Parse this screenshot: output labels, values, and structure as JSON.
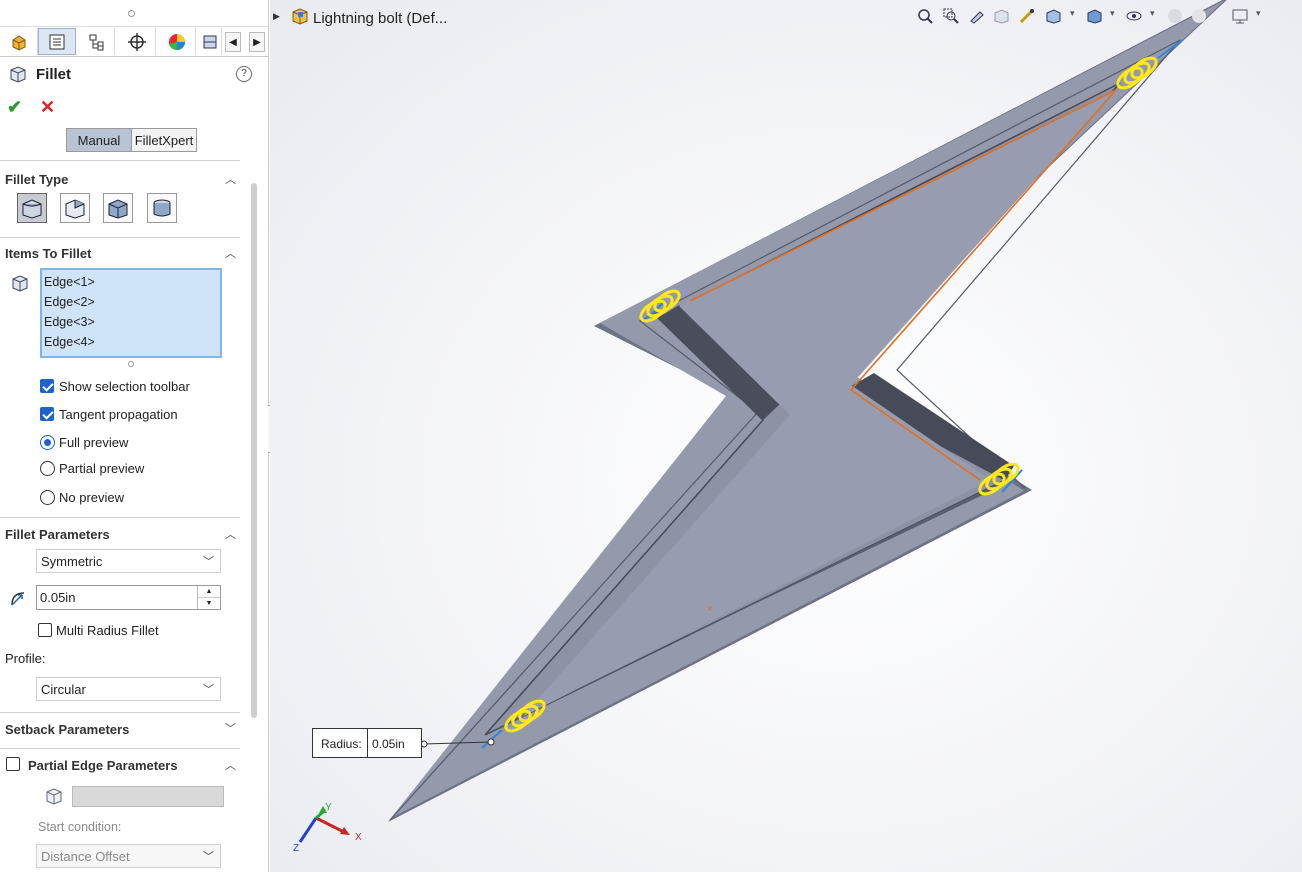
{
  "document": {
    "title": "Lightning bolt  (Def..."
  },
  "property_manager": {
    "title": "Fillet",
    "help_label": "?",
    "ok_icon": "checkmark-icon",
    "cancel_icon": "x-icon",
    "mode_tabs": {
      "manual": "Manual",
      "filletxpert": "FilletXpert",
      "selected": "Manual"
    },
    "fillet_type": {
      "label": "Fillet Type",
      "selected_index": 0
    },
    "items_to_fillet": {
      "label": "Items To Fillet",
      "edges": [
        "Edge<1>",
        "Edge<2>",
        "Edge<3>",
        "Edge<4>"
      ],
      "show_selection_toolbar": {
        "label": "Show selection toolbar",
        "checked": true
      },
      "tangent_propagation": {
        "label": "Tangent propagation",
        "checked": true
      },
      "preview": {
        "full": "Full preview",
        "partial": "Partial preview",
        "none": "No preview",
        "selected": "Full preview"
      }
    },
    "fillet_parameters": {
      "label": "Fillet Parameters",
      "method": "Symmetric",
      "radius": "0.05in",
      "multi_radius": {
        "label": "Multi Radius Fillet",
        "checked": false
      },
      "profile_label": "Profile:",
      "profile": "Circular"
    },
    "setback_parameters": {
      "label": "Setback Parameters"
    },
    "partial_edge_parameters": {
      "label": "Partial Edge Parameters",
      "checked": false,
      "start_condition_label": "Start condition:",
      "start_condition": "Distance Offset"
    }
  },
  "viewport": {
    "radius_callout": {
      "key": "Radius:",
      "value": "0.05in"
    },
    "triad": {
      "x": "X",
      "y": "Y",
      "z": "Z"
    }
  },
  "colors": {
    "part_face": "#8f95a8",
    "part_dark": "#4d5160",
    "fillet_preview": "#ffe81a",
    "selected_edge": "#e07020",
    "accent": "#1d63c9"
  }
}
